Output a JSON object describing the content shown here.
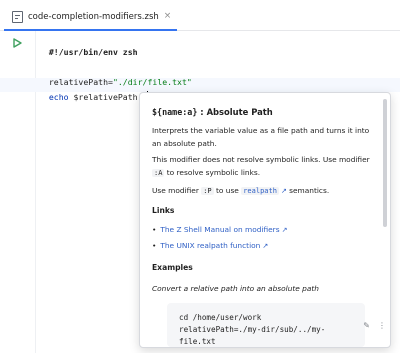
{
  "tab": {
    "filename": "code-completion-modifiers.zsh",
    "close_glyph": "×"
  },
  "editor": {
    "line1": "#!/usr/bin/env zsh",
    "line3": {
      "name": "relativePath=",
      "value": "\"./dir/file.txt\""
    },
    "line4": {
      "keyword": "echo",
      "text": " $relativePath:a"
    }
  },
  "doc": {
    "title_code": "${name:a}",
    "title_text": " : Absolute Path",
    "p1": "Interprets the variable value as a file path and turns it into an absolute path.",
    "p2_before": "This modifier does not resolve symbolic links. Use modifier ",
    "p2_code": ":A",
    "p2_after": " to resolve symbolic links.",
    "p3_before": "Use modifier ",
    "p3_code": ":P",
    "p3_mid": " to use ",
    "p3_link": "realpath",
    "p3_ext": "↗",
    "p3_after": " semantics.",
    "links_heading": "Links",
    "links": [
      {
        "label": "The Z Shell Manual on modifiers",
        "ext": "↗"
      },
      {
        "label": "The UNIX realpath function",
        "ext": "↗"
      }
    ],
    "examples_heading": "Examples",
    "example_caption": "Convert a relative path into an absolute path",
    "code_lines": [
      "cd /home/user/work",
      "relativePath=./my-dir/sub/../my-",
      "file.txt"
    ],
    "bullet_glyph": "•"
  },
  "icons": {
    "run": "run-icon",
    "pencil": "✎",
    "more": "⋮"
  },
  "colors": {
    "accent": "#3574f0",
    "link": "#2e5fc5",
    "string": "#067d17",
    "keyword": "#0033b3",
    "run": "#3ea05e"
  }
}
